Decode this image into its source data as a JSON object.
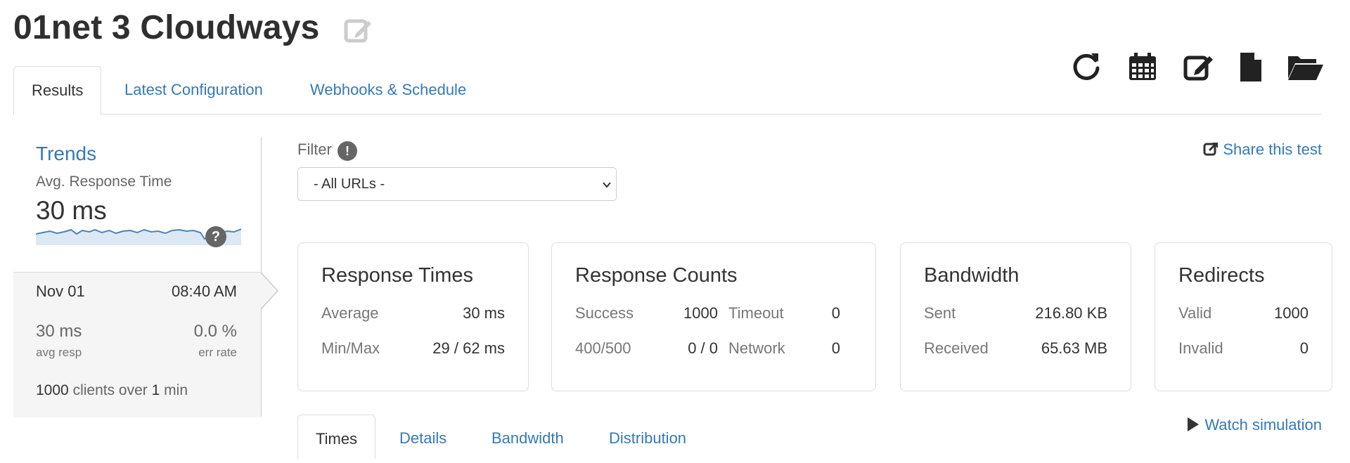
{
  "header": {
    "title": "01net 3 Cloudways",
    "toolbar_icons": [
      "refresh-icon",
      "calendar-icon",
      "edit-icon",
      "file-icon",
      "folder-open-icon"
    ]
  },
  "tabs": [
    {
      "label": "Results",
      "active": true
    },
    {
      "label": "Latest Configuration",
      "active": false
    },
    {
      "label": "Webhooks & Schedule",
      "active": false
    }
  ],
  "trends": {
    "title": "Trends",
    "subtitle": "Avg. Response Time",
    "value": "30 ms",
    "help": "?",
    "card": {
      "date": "Nov 01",
      "time": "08:40 AM",
      "avg_value": "30 ms",
      "avg_label": "avg resp",
      "err_value": "0.0 %",
      "err_label": "err rate",
      "clients_count": "1000",
      "clients_text": "clients over",
      "duration_num": "1",
      "duration_unit": "min"
    }
  },
  "filter": {
    "label": "Filter",
    "info": "!",
    "selected": "- All URLs -"
  },
  "share": {
    "label": "Share this test"
  },
  "cards": {
    "response_times": {
      "title": "Response Times",
      "average_label": "Average",
      "average_value": "30 ms",
      "minmax_label": "Min/Max",
      "minmax_value": "29 / 62 ms"
    },
    "response_counts": {
      "title": "Response Counts",
      "success_label": "Success",
      "success_value": "1000",
      "timeout_label": "Timeout",
      "timeout_value": "0",
      "err_label": "400/500",
      "err_value": "0 / 0",
      "network_label": "Network",
      "network_value": "0"
    },
    "bandwidth": {
      "title": "Bandwidth",
      "sent_label": "Sent",
      "sent_value": "216.80 KB",
      "received_label": "Received",
      "received_value": "65.63 MB"
    },
    "redirects": {
      "title": "Redirects",
      "valid_label": "Valid",
      "valid_value": "1000",
      "invalid_label": "Invalid",
      "invalid_value": "0"
    }
  },
  "subtabs": [
    {
      "label": "Times",
      "active": true
    },
    {
      "label": "Details",
      "active": false
    },
    {
      "label": "Bandwidth",
      "active": false
    },
    {
      "label": "Distribution",
      "active": false
    }
  ],
  "watch": {
    "label": "Watch simulation"
  },
  "colors": {
    "link": "#337ab7",
    "text": "#333333",
    "muted": "#777777",
    "sparkline": "#4a84b8",
    "sparkfill": "#dce8f4"
  }
}
